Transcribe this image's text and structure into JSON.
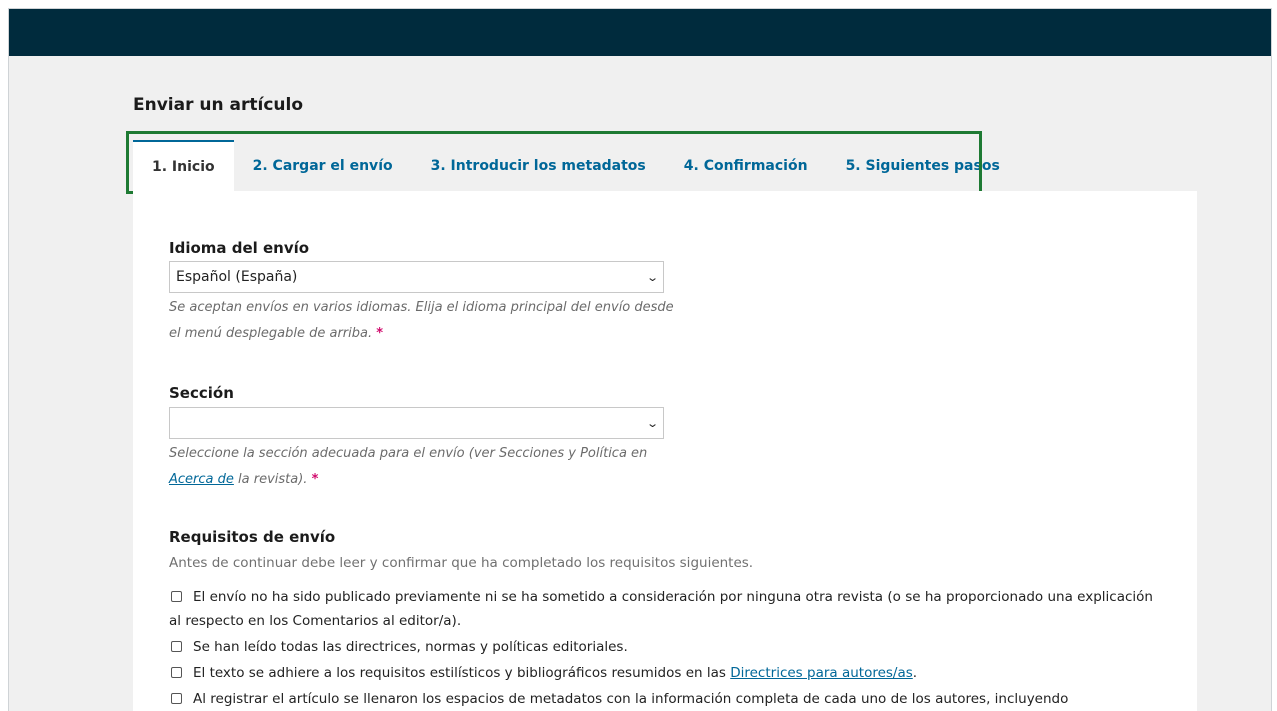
{
  "header": {
    "title": "Enviar un artículo"
  },
  "tabs": [
    {
      "label": "1. Inicio"
    },
    {
      "label": "2. Cargar el envío"
    },
    {
      "label": "3. Introducir los metadatos"
    },
    {
      "label": "4. Confirmación"
    },
    {
      "label": "5. Siguientes pasos"
    }
  ],
  "form": {
    "language": {
      "label": "Idioma del envío",
      "value": "Español (España)",
      "help": "Se aceptan envíos en varios idiomas. Elija el idioma principal del envío desde el menú desplegable de arriba.",
      "required_mark": "*"
    },
    "section": {
      "label": "Sección",
      "value": "",
      "help_before": "Seleccione la sección adecuada para el envío (ver Secciones y Política en ",
      "help_link": "Acerca de",
      "help_after": " la revista).",
      "required_mark": "*"
    },
    "requirements": {
      "title": "Requisitos de envío",
      "description": "Antes de continuar debe leer y confirmar que ha completado los requisitos siguientes.",
      "items": [
        {
          "text": "El envío no ha sido publicado previamente ni se ha sometido a consideración por ninguna otra revista (o se ha proporcionado una explicación al respecto en los Comentarios al editor/a)."
        },
        {
          "text": "Se han leído todas las directrices, normas y políticas editoriales."
        },
        {
          "text_before": "El texto se adhiere a los requisitos estilísticos y bibliográficos resumidos en las ",
          "link": "Directrices para autores/as",
          "text_after": "."
        },
        {
          "text": "Al registrar el artículo se llenaron los espacios de metadatos con la información completa de cada uno de los autores, incluyendo"
        }
      ]
    }
  },
  "colors": {
    "topbar": "#002b3d",
    "accent": "#006798",
    "highlight_border": "#1e7a33",
    "required": "#d00a6c"
  }
}
